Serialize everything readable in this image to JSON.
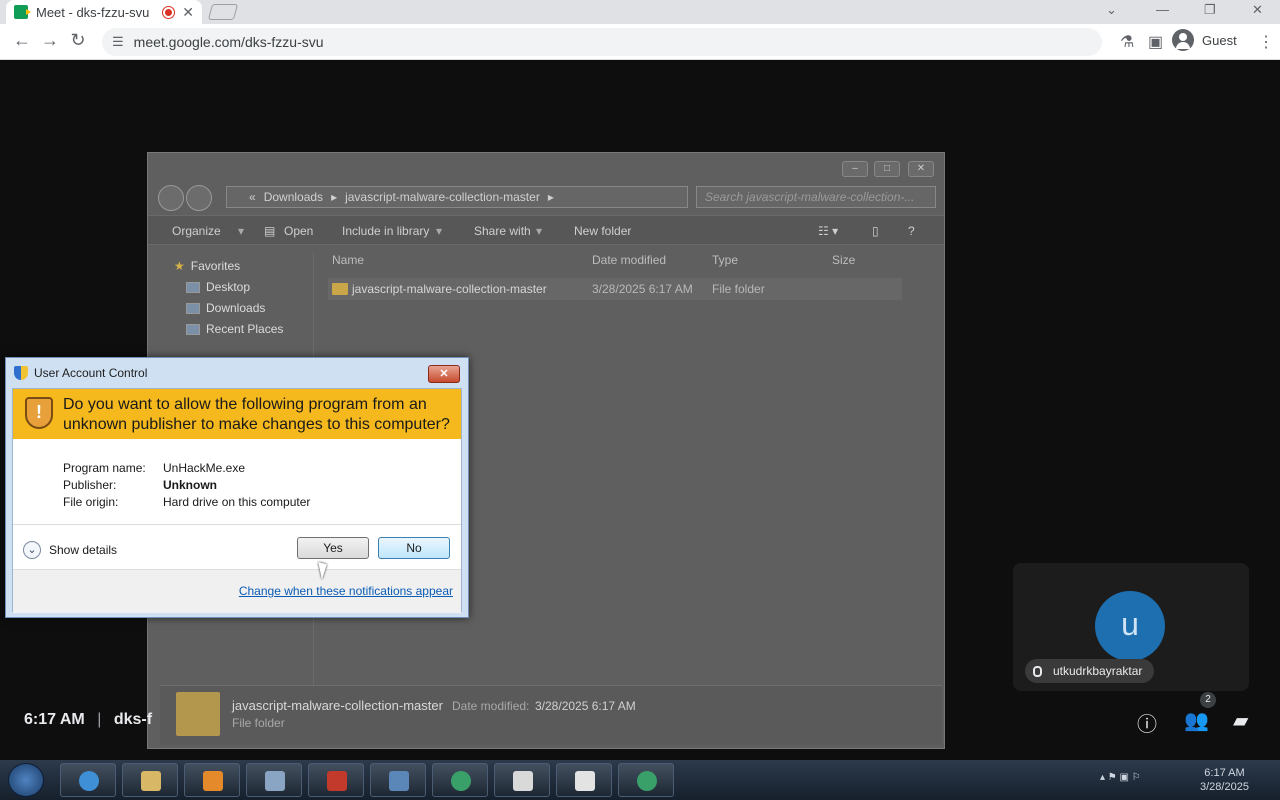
{
  "browser": {
    "tab_title": "Meet - dks-fzzu-svu",
    "url": "meet.google.com/dks-fzzu-svu",
    "profile": "Guest"
  },
  "explorer": {
    "breadcrumb": [
      "Downloads",
      "javascript-malware-collection-master"
    ],
    "search_placeholder": "Search javascript-malware-collection-...",
    "commands": [
      "Organize",
      "Open",
      "Include in library",
      "Share with",
      "New folder"
    ],
    "nav": {
      "favorites": "Favorites",
      "items": [
        "Desktop",
        "Downloads",
        "Recent Places"
      ]
    },
    "columns": [
      "Name",
      "Date modified",
      "Type",
      "Size"
    ],
    "files": [
      {
        "name": "javascript-malware-collection-master",
        "date": "3/28/2025 6:17 AM",
        "type": "File folder",
        "size": ""
      }
    ],
    "details": {
      "name": "javascript-malware-collection-master",
      "date_label": "Date modified:",
      "date": "3/28/2025 6:17 AM",
      "type": "File folder"
    }
  },
  "uac": {
    "title": "User Account Control",
    "question": "Do you want to allow the following program from an unknown publisher to make changes to this computer?",
    "fields": [
      {
        "label": "Program name:",
        "value": "UnHackMe.exe"
      },
      {
        "label": "Publisher:",
        "value": "Unknown"
      },
      {
        "label": "File origin:",
        "value": "Hard drive on this computer"
      }
    ],
    "show_details": "Show details",
    "yes": "Yes",
    "no": "No",
    "link": "Change when these notifications appear"
  },
  "meet": {
    "participant": "utkudrkbayraktar",
    "avatar_letter": "u",
    "time": "6:17 AM",
    "separator": "|",
    "code": "dks-f",
    "participant_count": "2"
  },
  "taskbar": {
    "time": "6:17 AM",
    "date": "3/28/2025"
  }
}
